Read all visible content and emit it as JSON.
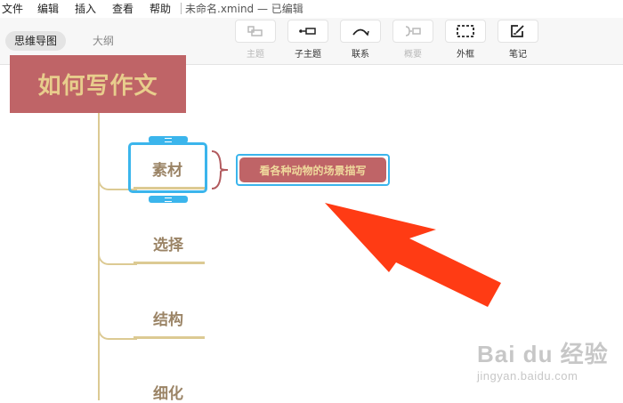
{
  "menu": {
    "items": [
      "文件",
      "编辑",
      "插入",
      "查看",
      "帮助"
    ],
    "document_title": "未命名.xmind — 已编辑"
  },
  "toolbar": {
    "view_tabs": [
      "思维导图",
      "大纲"
    ],
    "tools": [
      {
        "label": "主题",
        "icon": "topic-icon",
        "enabled": false
      },
      {
        "label": "子主题",
        "icon": "subtopic-icon",
        "enabled": true
      },
      {
        "label": "联系",
        "icon": "relationship-icon",
        "enabled": true
      },
      {
        "label": "概要",
        "icon": "summary-icon",
        "enabled": false
      },
      {
        "label": "外框",
        "icon": "boundary-icon",
        "enabled": true
      },
      {
        "label": "笔记",
        "icon": "note-icon",
        "enabled": true
      }
    ]
  },
  "mindmap": {
    "root": "如何写作文",
    "branches": [
      "素材",
      "选择",
      "结构",
      "细化"
    ],
    "selected_branch": "素材",
    "summary_topic": "看各种动物的场景描写"
  },
  "watermark": {
    "main": "Bai du 经验",
    "sub": "jingyan.baidu.com"
  },
  "colors": {
    "root_fill": "#bf6467",
    "root_text": "#e8cd8c",
    "branch_line": "#dcca93",
    "branch_text": "#9b8466",
    "selection": "#3bb5ec",
    "arrow": "#ff3b14"
  }
}
